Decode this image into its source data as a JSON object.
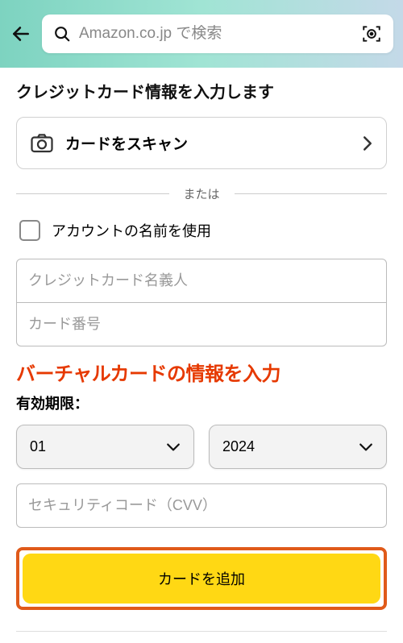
{
  "header": {
    "search_placeholder": "Amazon.co.jp で検索"
  },
  "form": {
    "title": "クレジットカード情報を入力します",
    "scan_label": "カードをスキャン",
    "divider_text": "または",
    "use_account_name_label": "アカウントの名前を使用",
    "cardholder_placeholder": "クレジットカード名義人",
    "cardnumber_placeholder": "カード番号",
    "annotation_text": "バーチャルカードの情報を入力",
    "expiry_label": "有効期限：",
    "expiry_month": "01",
    "expiry_year": "2024",
    "cvv_placeholder": "セキュリティコード（CVV）",
    "submit_label": "カードを追加"
  }
}
